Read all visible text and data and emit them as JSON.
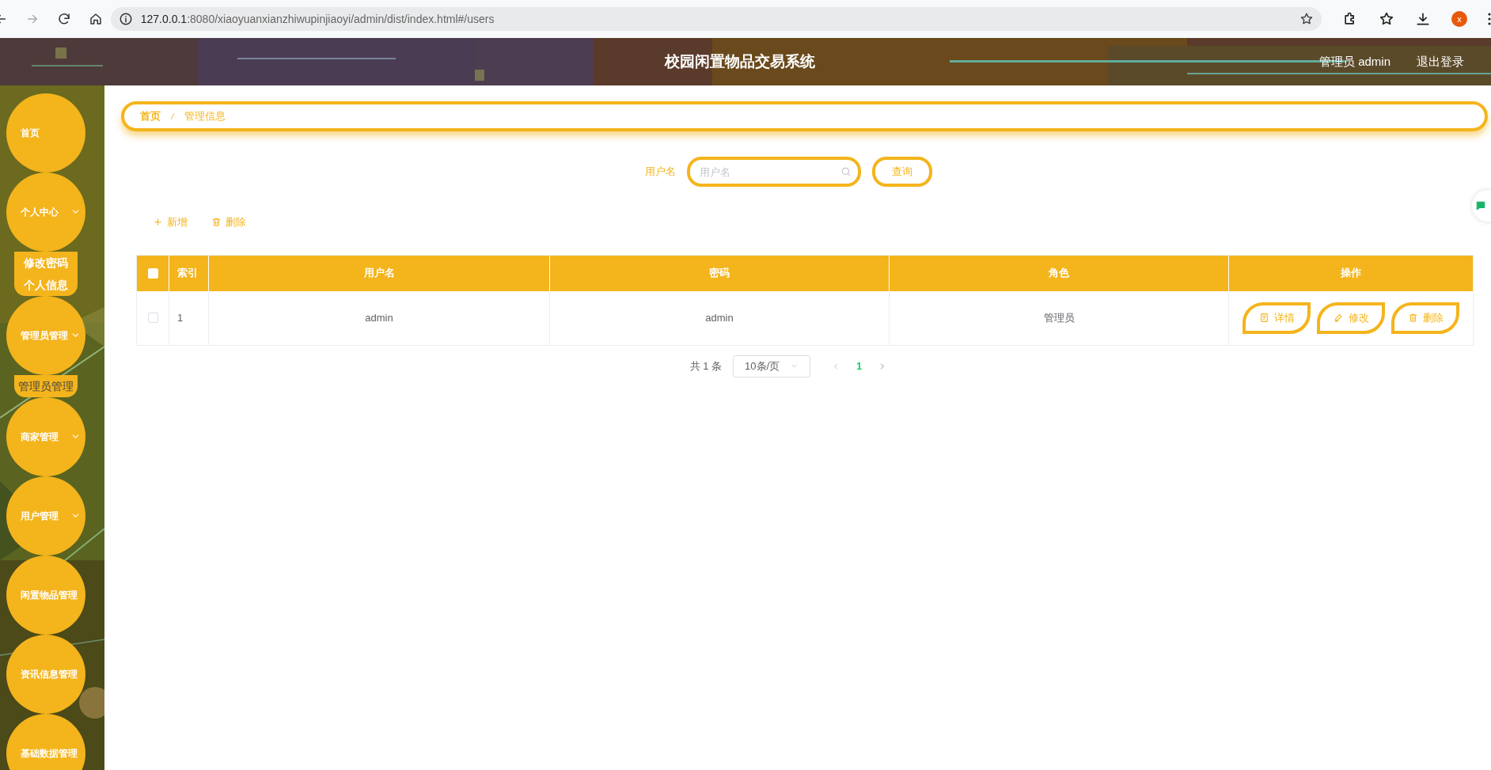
{
  "browser": {
    "url_host": "127.0.0.1",
    "url_rest": ":8080/xiaoyuanxianzhiwupinjiaoyi/admin/dist/index.html#/users",
    "profile_initial": "x"
  },
  "header": {
    "title": "校园闲置物品交易系统",
    "user": "管理员 admin",
    "logout": "退出登录"
  },
  "sidebar": {
    "items": [
      {
        "label": "首页",
        "expandable": false
      },
      {
        "label": "个人中心",
        "expandable": true,
        "children": [
          {
            "label": "修改密码"
          },
          {
            "label": "个人信息"
          }
        ]
      },
      {
        "label": "管理员管理",
        "expandable": true,
        "children": [
          {
            "label": "管理员管理"
          }
        ]
      },
      {
        "label": "商家管理",
        "expandable": true
      },
      {
        "label": "用户管理",
        "expandable": true
      },
      {
        "label": "闲置物品管理",
        "expandable": false
      },
      {
        "label": "资讯信息管理",
        "expandable": false
      },
      {
        "label": "基础数据管理",
        "expandable": false
      }
    ]
  },
  "breadcrumb": [
    {
      "label": "首页",
      "current": false
    },
    {
      "label": "管理信息",
      "current": true
    }
  ],
  "search": {
    "label": "用户名",
    "placeholder": "用户名",
    "button": "查询"
  },
  "toolbar": [
    {
      "kind": "add",
      "label": "新增"
    },
    {
      "kind": "delete",
      "label": "删除"
    }
  ],
  "table": {
    "select_all": {
      "checked": false
    },
    "columns": [
      "索引",
      "用户名",
      "密码",
      "角色",
      "操作"
    ],
    "rows": [
      {
        "checked": false,
        "cells": [
          "1",
          "admin",
          "admin",
          "管理员"
        ],
        "actions": [
          {
            "kind": "detail",
            "label": "详情"
          },
          {
            "kind": "edit",
            "label": "修改"
          },
          {
            "kind": "delete",
            "label": "删除"
          }
        ]
      }
    ]
  },
  "pagination": {
    "total": "共 1 条",
    "page_size": "10条/页",
    "pages": [
      {
        "label": "1",
        "selected": true
      }
    ]
  }
}
